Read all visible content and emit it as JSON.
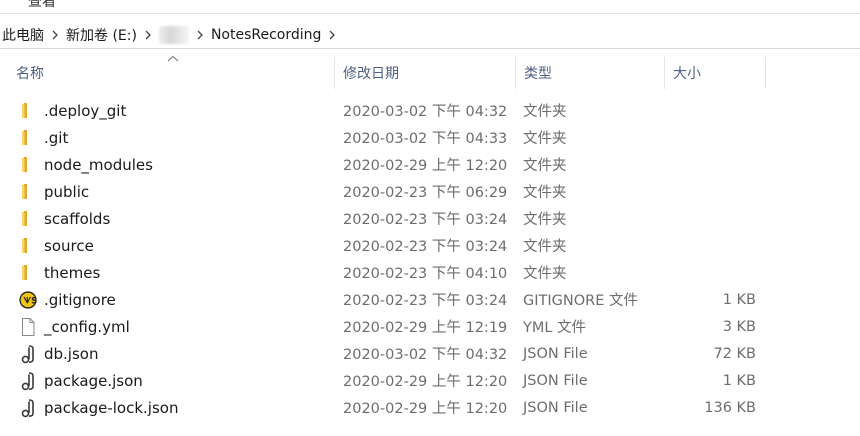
{
  "ribbon": {
    "tab_label": "查看"
  },
  "address": {
    "crumbs": [
      "此电脑",
      "新加卷 (E:)",
      "NotesRecording"
    ]
  },
  "columns": {
    "name": "名称",
    "date": "修改日期",
    "type": "类型",
    "size": "大小"
  },
  "files": [
    {
      "name": ".deploy_git",
      "date": "2020-03-02 下午 04:32",
      "type": "文件夹",
      "size": "",
      "icon": "folder-icon"
    },
    {
      "name": ".git",
      "date": "2020-03-02 下午 04:33",
      "type": "文件夹",
      "size": "",
      "icon": "folder-icon"
    },
    {
      "name": "node_modules",
      "date": "2020-02-29 上午 12:20",
      "type": "文件夹",
      "size": "",
      "icon": "folder-icon"
    },
    {
      "name": "public",
      "date": "2020-02-23 下午 06:29",
      "type": "文件夹",
      "size": "",
      "icon": "folder-icon"
    },
    {
      "name": "scaffolds",
      "date": "2020-02-23 下午 03:24",
      "type": "文件夹",
      "size": "",
      "icon": "folder-icon"
    },
    {
      "name": "source",
      "date": "2020-02-23 下午 03:24",
      "type": "文件夹",
      "size": "",
      "icon": "folder-icon"
    },
    {
      "name": "themes",
      "date": "2020-02-23 下午 04:10",
      "type": "文件夹",
      "size": "",
      "icon": "folder-icon"
    },
    {
      "name": ".gitignore",
      "date": "2020-02-23 下午 03:24",
      "type": "GITIGNORE 文件",
      "size": "1 KB",
      "icon": "gitignore-file-icon"
    },
    {
      "name": "_config.yml",
      "date": "2020-02-29 上午 12:19",
      "type": "YML 文件",
      "size": "3 KB",
      "icon": "blank-file-icon"
    },
    {
      "name": "db.json",
      "date": "2020-03-02 下午 04:32",
      "type": "JSON File",
      "size": "72 KB",
      "icon": "json-file-icon"
    },
    {
      "name": "package.json",
      "date": "2020-02-29 上午 12:20",
      "type": "JSON File",
      "size": "1 KB",
      "icon": "json-file-icon"
    },
    {
      "name": "package-lock.json",
      "date": "2020-02-29 上午 12:20",
      "type": "JSON File",
      "size": "136 KB",
      "icon": "json-file-icon"
    }
  ],
  "colors": {
    "folder": "#f8c74a",
    "folder_dark": "#e0a92a",
    "header_text": "#4d6082"
  }
}
